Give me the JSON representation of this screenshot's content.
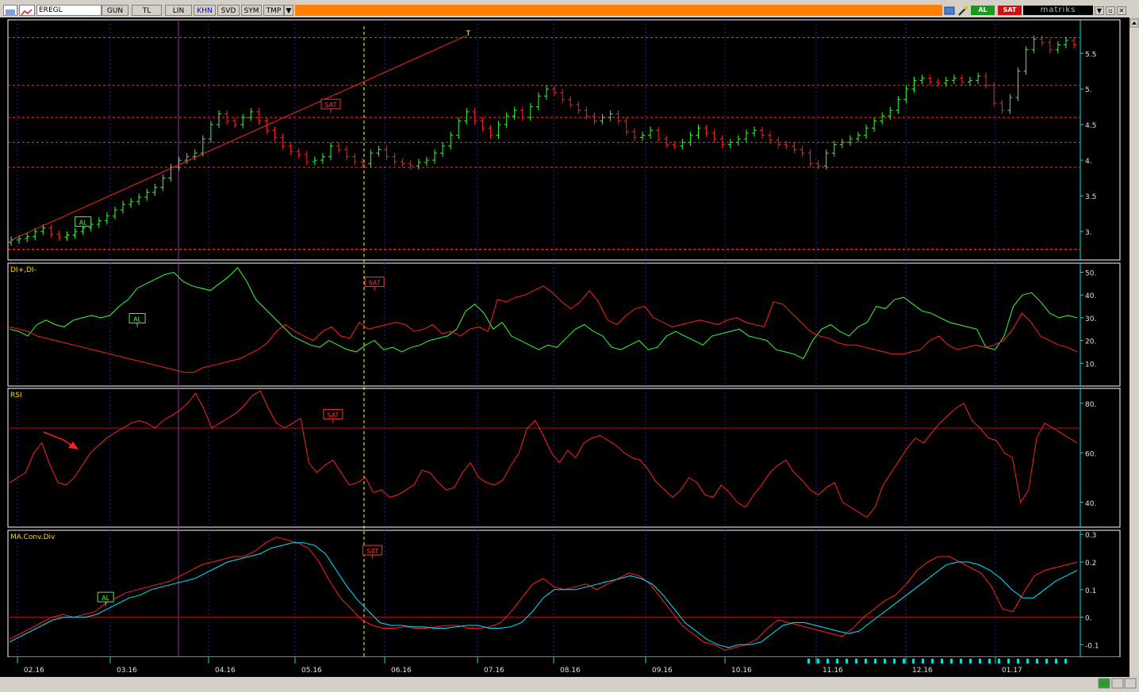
{
  "toolbar": {
    "symbol": "EREGL",
    "buttons": [
      "GUN",
      "TL",
      "LIN",
      "KHN",
      "SVD",
      "SYM",
      "TMP"
    ],
    "dropdown_glyph": "▼",
    "al_label": "AL",
    "sat_label": "SAT",
    "brand": "matriks",
    "window_buttons": [
      "▼",
      "▫",
      "✕"
    ]
  },
  "colors": {
    "background": "#000000",
    "up": "#33ff33",
    "down": "#ff2020",
    "grid": "#ff3030",
    "signal": "#00e5ff",
    "axis": "#00e0e0",
    "title": "#ffd700"
  },
  "chart_data": [
    {
      "type": "candlestick",
      "title": "",
      "yticks": [
        3,
        3.5,
        4,
        4.5,
        5,
        5.5
      ],
      "yticklabels": [
        "3.",
        "3.5",
        "4.",
        "4.5",
        "5.",
        "5.5"
      ],
      "ylim": [
        2.6,
        5.97
      ],
      "h_lines": [
        2.75,
        3.9,
        4.25,
        4.6,
        5.05,
        5.72
      ],
      "x_month_labels": [
        "02.16",
        "03.16",
        "04.16",
        "05.16",
        "06.16",
        "07.16",
        "08.16",
        "09.16",
        "10.16",
        "11.16",
        "12.16",
        "01.17"
      ],
      "close_series": [
        2.88,
        2.9,
        2.93,
        3.0,
        3.05,
        2.96,
        2.92,
        2.95,
        3.0,
        3.05,
        3.1,
        3.15,
        3.22,
        3.3,
        3.38,
        3.42,
        3.48,
        3.55,
        3.62,
        3.75,
        3.9,
        4.0,
        4.05,
        4.1,
        4.3,
        4.5,
        4.65,
        4.55,
        4.5,
        4.6,
        4.68,
        4.55,
        4.42,
        4.32,
        4.2,
        4.12,
        4.08,
        3.98,
        4.0,
        4.05,
        4.2,
        4.15,
        4.05,
        3.98,
        3.95,
        4.1,
        4.15,
        4.05,
        3.98,
        3.95,
        3.92,
        3.97,
        4.0,
        4.1,
        4.2,
        4.35,
        4.55,
        4.68,
        4.55,
        4.45,
        4.35,
        4.5,
        4.62,
        4.7,
        4.6,
        4.75,
        4.9,
        5.0,
        4.95,
        4.85,
        4.78,
        4.7,
        4.62,
        4.55,
        4.6,
        4.65,
        4.55,
        4.4,
        4.32,
        4.35,
        4.42,
        4.3,
        4.22,
        4.2,
        4.25,
        4.35,
        4.45,
        4.38,
        4.3,
        4.22,
        4.25,
        4.3,
        4.38,
        4.42,
        4.35,
        4.28,
        4.22,
        4.2,
        4.15,
        4.1,
        3.95,
        3.92,
        4.1,
        4.22,
        4.25,
        4.3,
        4.35,
        4.45,
        4.55,
        4.62,
        4.7,
        4.85,
        5.0,
        5.12,
        5.15,
        5.1,
        5.08,
        5.12,
        5.15,
        5.1,
        5.12,
        5.18,
        5.05,
        4.8,
        4.7,
        4.88,
        5.25,
        5.55,
        5.7,
        5.65,
        5.55,
        5.62,
        5.68,
        5.62
      ],
      "annotations": [
        {
          "label": "AL",
          "index": 9,
          "value": 3.05
        },
        {
          "label": "SAT",
          "index": 40,
          "value": 4.7
        },
        {
          "label": "T",
          "index": 57,
          "value": 5.75
        }
      ],
      "trendline": {
        "from": [
          0,
          2.88
        ],
        "to": [
          57,
          5.75
        ]
      }
    },
    {
      "type": "line",
      "title": "DI+,DI-",
      "yticks": [
        10,
        20,
        30,
        40,
        50
      ],
      "yticklabels": [
        "10.",
        "20.",
        "30.",
        "40.",
        "50."
      ],
      "ylim": [
        0,
        54
      ],
      "series": [
        {
          "name": "DI+",
          "color": "#33ff33",
          "values": [
            25,
            24,
            22,
            27,
            29,
            27,
            26,
            29,
            30,
            31,
            30,
            31,
            35,
            38,
            43,
            45,
            47,
            49,
            50,
            46,
            44,
            43,
            42,
            45,
            48,
            52,
            46,
            38,
            34,
            30,
            26,
            22,
            20,
            18,
            17,
            20,
            18,
            16,
            15,
            18,
            20,
            16,
            17,
            15,
            17,
            18,
            20,
            21,
            22,
            25,
            33,
            36,
            32,
            25,
            28,
            22,
            20,
            18,
            16,
            18,
            17,
            21,
            25,
            27,
            24,
            22,
            17,
            16,
            18,
            20,
            16,
            17,
            22,
            24,
            22,
            20,
            18,
            22,
            23,
            24,
            25,
            22,
            21,
            20,
            16,
            15,
            14,
            12,
            20,
            25,
            27,
            24,
            22,
            26,
            28,
            35,
            34,
            38,
            39,
            36,
            33,
            32,
            30,
            28,
            27,
            26,
            25,
            17,
            16,
            22,
            35,
            40,
            41,
            37,
            32,
            30,
            31,
            30
          ]
        },
        {
          "name": "DI-",
          "color": "#ff2020",
          "values": [
            26,
            25,
            24,
            22,
            21,
            20,
            19,
            18,
            17,
            16,
            15,
            14,
            13,
            12,
            11,
            10,
            9,
            8,
            7,
            6,
            6,
            8,
            9,
            10,
            11,
            12,
            14,
            16,
            19,
            24,
            27,
            24,
            22,
            20,
            24,
            26,
            22,
            21,
            28,
            25,
            26,
            27,
            28,
            27,
            24,
            25,
            27,
            23,
            24,
            22,
            25,
            26,
            24,
            38,
            37,
            39,
            40,
            42,
            44,
            41,
            37,
            34,
            37,
            42,
            37,
            29,
            27,
            31,
            34,
            35,
            30,
            28,
            26,
            27,
            28,
            29,
            28,
            27,
            29,
            30,
            28,
            27,
            26,
            37,
            36,
            32,
            28,
            24,
            22,
            21,
            19,
            18,
            18,
            17,
            16,
            15,
            14,
            14,
            15,
            16,
            20,
            22,
            18,
            16,
            17,
            18,
            17,
            18,
            20,
            25,
            32,
            28,
            22,
            20,
            18,
            17,
            15
          ]
        }
      ],
      "annotations": [
        {
          "label": "AL",
          "index": 14,
          "value": 27
        },
        {
          "label": "SAT",
          "index": 40,
          "value": 43
        }
      ]
    },
    {
      "type": "line",
      "title": "RSI",
      "yticks": [
        40,
        60,
        80
      ],
      "yticklabels": [
        "40.",
        "60.",
        "80."
      ],
      "ylim": [
        30,
        86
      ],
      "h_line": 70,
      "series": [
        {
          "name": "RSI",
          "color": "#ff2020",
          "values": [
            48,
            50,
            52,
            60,
            64,
            55,
            48,
            47,
            50,
            55,
            60,
            63,
            66,
            68,
            70,
            72,
            73,
            72,
            70,
            73,
            75,
            77,
            80,
            84,
            78,
            70,
            72,
            74,
            76,
            79,
            83,
            85,
            78,
            72,
            70,
            72,
            74,
            56,
            52,
            55,
            57,
            52,
            47,
            48,
            50,
            44,
            45,
            42,
            43,
            45,
            47,
            53,
            52,
            48,
            45,
            46,
            52,
            56,
            50,
            48,
            47,
            49,
            55,
            60,
            70,
            73,
            67,
            60,
            56,
            61,
            58,
            64,
            66,
            67,
            65,
            63,
            60,
            58,
            57,
            53,
            48,
            45,
            42,
            45,
            50,
            48,
            43,
            42,
            47,
            44,
            40,
            38,
            43,
            47,
            52,
            55,
            57,
            52,
            49,
            45,
            43,
            46,
            48,
            40,
            38,
            36,
            34,
            38,
            47,
            52,
            57,
            62,
            66,
            64,
            68,
            72,
            75,
            78,
            80,
            73,
            70,
            66,
            65,
            60,
            58,
            40,
            45,
            66,
            72,
            70,
            68,
            66,
            64
          ]
        }
      ],
      "annotations": [
        {
          "label": "SAT",
          "index": 40,
          "value": 73
        }
      ]
    },
    {
      "type": "line",
      "title": "MA.Conv.Div",
      "yticks": [
        -0.1,
        0,
        0.1,
        0.2,
        0.3
      ],
      "yticklabels": [
        "-0.1",
        "0.",
        "0.1",
        "0.2",
        "0.3"
      ],
      "ylim": [
        -0.145,
        0.315
      ],
      "h_line": 0,
      "series": [
        {
          "name": "MACD",
          "color": "#ff2020",
          "values": [
            -0.08,
            -0.06,
            -0.04,
            -0.02,
            0.0,
            0.01,
            0.0,
            0.01,
            0.02,
            0.05,
            0.07,
            0.09,
            0.1,
            0.11,
            0.12,
            0.13,
            0.15,
            0.17,
            0.19,
            0.2,
            0.21,
            0.22,
            0.22,
            0.24,
            0.27,
            0.29,
            0.28,
            0.27,
            0.25,
            0.2,
            0.13,
            0.07,
            0.03,
            -0.01,
            -0.03,
            -0.04,
            -0.04,
            -0.035,
            -0.04,
            -0.04,
            -0.035,
            -0.03,
            -0.03,
            -0.04,
            -0.04,
            -0.035,
            -0.02,
            0.02,
            0.07,
            0.12,
            0.14,
            0.11,
            0.1,
            0.11,
            0.12,
            0.1,
            0.12,
            0.14,
            0.16,
            0.15,
            0.12,
            0.07,
            0.02,
            -0.03,
            -0.06,
            -0.09,
            -0.1,
            -0.12,
            -0.11,
            -0.1,
            -0.08,
            -0.04,
            -0.01,
            -0.02,
            -0.03,
            -0.04,
            -0.05,
            -0.06,
            -0.07,
            -0.04,
            0.0,
            0.03,
            0.06,
            0.08,
            0.12,
            0.17,
            0.2,
            0.22,
            0.22,
            0.2,
            0.18,
            0.16,
            0.11,
            0.03,
            0.02,
            0.09,
            0.15,
            0.17,
            0.18,
            0.19,
            0.2
          ]
        },
        {
          "name": "Signal",
          "color": "#00e5ff",
          "values": [
            -0.09,
            -0.07,
            -0.05,
            -0.03,
            -0.01,
            0.0,
            0.0,
            0.0,
            0.01,
            0.03,
            0.05,
            0.07,
            0.08,
            0.1,
            0.11,
            0.12,
            0.13,
            0.14,
            0.16,
            0.18,
            0.2,
            0.21,
            0.22,
            0.23,
            0.25,
            0.26,
            0.27,
            0.27,
            0.26,
            0.23,
            0.17,
            0.11,
            0.06,
            0.02,
            -0.02,
            -0.03,
            -0.03,
            -0.035,
            -0.035,
            -0.04,
            -0.04,
            -0.035,
            -0.03,
            -0.03,
            -0.04,
            -0.04,
            -0.035,
            -0.02,
            0.02,
            0.07,
            0.1,
            0.1,
            0.1,
            0.11,
            0.12,
            0.13,
            0.14,
            0.15,
            0.14,
            0.12,
            0.08,
            0.03,
            -0.02,
            -0.05,
            -0.08,
            -0.1,
            -0.11,
            -0.1,
            -0.1,
            -0.09,
            -0.06,
            -0.03,
            -0.02,
            -0.02,
            -0.03,
            -0.04,
            -0.05,
            -0.06,
            -0.05,
            -0.02,
            0.01,
            0.04,
            0.07,
            0.1,
            0.13,
            0.16,
            0.19,
            0.2,
            0.2,
            0.19,
            0.17,
            0.14,
            0.1,
            0.07,
            0.07,
            0.1,
            0.13,
            0.15,
            0.17
          ]
        }
      ],
      "annotations": [
        {
          "label": "AL",
          "index": 9,
          "value": 0.05
        },
        {
          "label": "SAT",
          "index": 34,
          "value": 0.22
        }
      ]
    }
  ]
}
